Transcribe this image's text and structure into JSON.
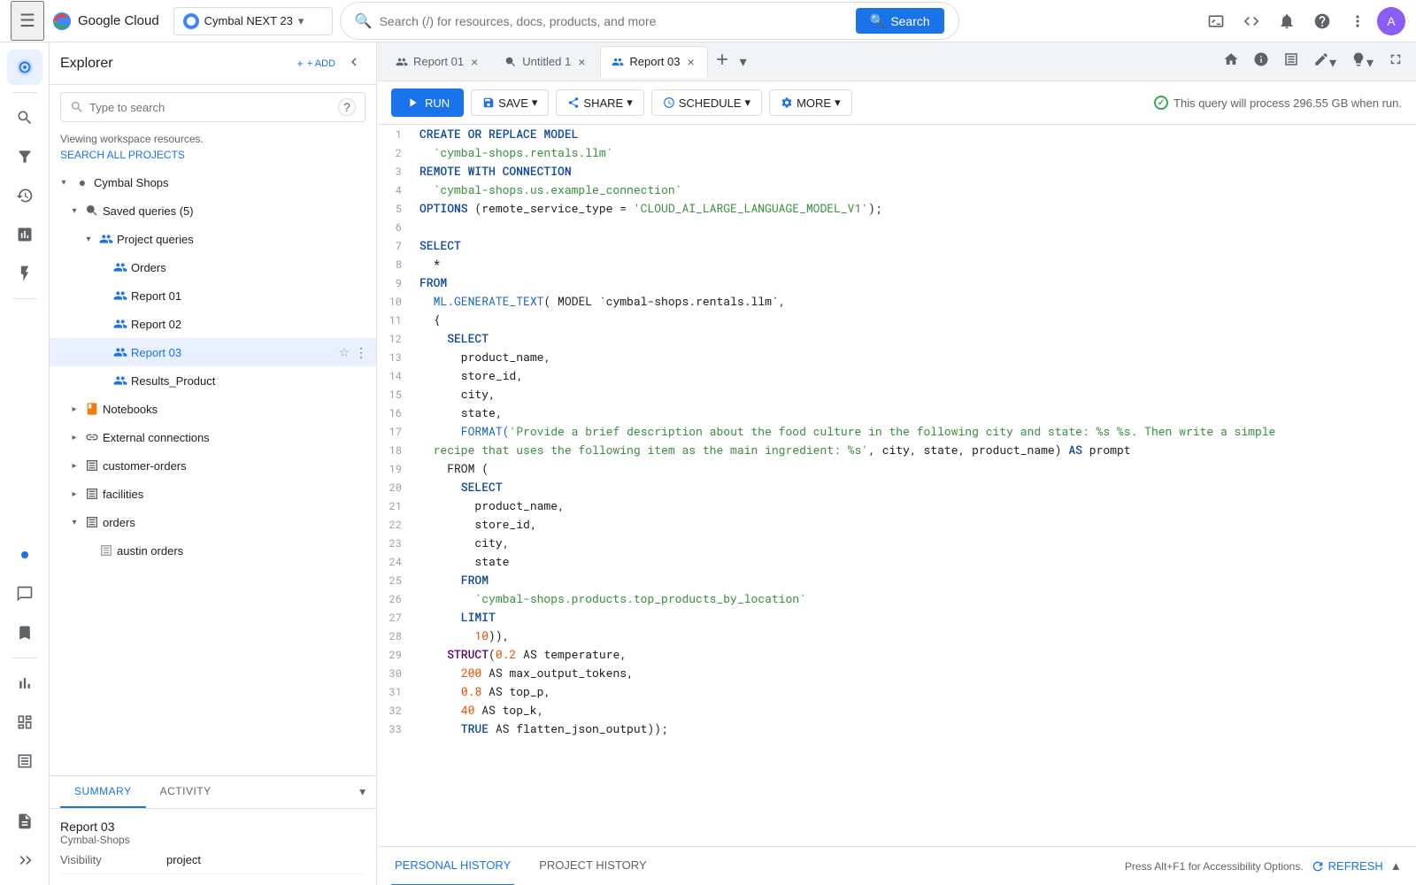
{
  "topnav": {
    "logo": {
      "letters": [
        {
          "char": "G",
          "color": "#4285f4"
        },
        {
          "char": "o",
          "color": "#ea4335"
        },
        {
          "char": "o",
          "color": "#fbbc04"
        },
        {
          "char": "g",
          "color": "#4285f4"
        },
        {
          "char": "l",
          "color": "#34a853"
        },
        {
          "char": "e",
          "color": "#ea4335"
        }
      ],
      "cloud_text": "Cloud"
    },
    "project": "Cymbal NEXT 23",
    "search_placeholder": "Search (/) for resources, docs, products, and more",
    "search_btn": "Search"
  },
  "explorer": {
    "title": "Explorer",
    "add_btn": "+ ADD",
    "search_placeholder": "Type to search",
    "workspace_text": "Viewing workspace resources.",
    "search_all_link": "SEARCH ALL PROJECTS"
  },
  "tree": {
    "items": [
      {
        "id": "cymbal-shops",
        "label": "Cymbal Shops",
        "indent": 0,
        "type": "folder",
        "expanded": true
      },
      {
        "id": "saved-queries",
        "label": "Saved queries (5)",
        "indent": 1,
        "type": "folder",
        "expanded": true
      },
      {
        "id": "project-queries",
        "label": "Project queries",
        "indent": 2,
        "type": "people-folder",
        "expanded": true
      },
      {
        "id": "orders",
        "label": "Orders",
        "indent": 3,
        "type": "people"
      },
      {
        "id": "report01",
        "label": "Report 01",
        "indent": 3,
        "type": "people"
      },
      {
        "id": "report02",
        "label": "Report 02",
        "indent": 3,
        "type": "people"
      },
      {
        "id": "report03",
        "label": "Report 03",
        "indent": 3,
        "type": "people",
        "active": true
      },
      {
        "id": "results-product",
        "label": "Results_Product",
        "indent": 3,
        "type": "people"
      },
      {
        "id": "notebooks",
        "label": "Notebooks",
        "indent": 1,
        "type": "notebook",
        "expanded": false
      },
      {
        "id": "ext-connections",
        "label": "External connections",
        "indent": 1,
        "type": "ext",
        "expanded": false
      },
      {
        "id": "customer-orders",
        "label": "customer-orders",
        "indent": 1,
        "type": "table",
        "expanded": false
      },
      {
        "id": "facilities",
        "label": "facilities",
        "indent": 1,
        "type": "table",
        "expanded": false
      },
      {
        "id": "orders-tbl",
        "label": "orders",
        "indent": 1,
        "type": "table",
        "expanded": true
      },
      {
        "id": "austin-orders",
        "label": "austin orders",
        "indent": 2,
        "type": "table-sub"
      }
    ]
  },
  "bottom_panel": {
    "tabs": [
      "SUMMARY",
      "ACTIVITY"
    ],
    "active_tab": "SUMMARY",
    "resource": {
      "name": "Report 03",
      "project": "Cymbal-Shops",
      "visibility_label": "Visibility",
      "visibility_value": "project"
    }
  },
  "tabs": [
    {
      "id": "report01",
      "label": "Report 01",
      "icon": "people",
      "active": false,
      "closeable": true
    },
    {
      "id": "untitled1",
      "label": "Untitled 1",
      "icon": "query",
      "active": false,
      "closeable": true
    },
    {
      "id": "report03",
      "label": "Report 03",
      "icon": "people",
      "active": true,
      "closeable": true
    }
  ],
  "toolbar": {
    "run_btn": "RUN",
    "save_btn": "SAVE",
    "share_btn": "SHARE",
    "schedule_btn": "SCHEDULE",
    "more_btn": "MORE",
    "info_text": "This query will process 296.55 GB when run."
  },
  "code": {
    "lines": [
      {
        "n": 1,
        "content": "CREATE OR REPLACE MODEL",
        "tokens": [
          {
            "t": "CREATE OR REPLACE MODEL",
            "c": "kw"
          }
        ]
      },
      {
        "n": 2,
        "content": "  `cymbal-shops.rentals.llm`",
        "tokens": [
          {
            "t": "  `cymbal-shops.rentals.llm`",
            "c": "str"
          }
        ]
      },
      {
        "n": 3,
        "content": "REMOTE WITH CONNECTION",
        "tokens": [
          {
            "t": "REMOTE WITH CONNECTION",
            "c": "kw"
          }
        ]
      },
      {
        "n": 4,
        "content": "  `cymbal-shops.us.example_connection`",
        "tokens": [
          {
            "t": "  `cymbal-shops.us.example_connection`",
            "c": "str"
          }
        ]
      },
      {
        "n": 5,
        "content": "OPTIONS (remote_service_type = 'CLOUD_AI_LARGE_LANGUAGE_MODEL_V1');",
        "tokens": [
          {
            "t": "OPTIONS",
            "c": "kw"
          },
          {
            "t": " (remote_service_type = ",
            "c": ""
          },
          {
            "t": "'CLOUD_AI_LARGE_LANGUAGE_MODEL_V1'",
            "c": "str"
          },
          {
            "t": ");",
            "c": ""
          }
        ]
      },
      {
        "n": 6,
        "content": ""
      },
      {
        "n": 7,
        "content": "SELECT",
        "tokens": [
          {
            "t": "SELECT",
            "c": "kw"
          }
        ]
      },
      {
        "n": 8,
        "content": "  *"
      },
      {
        "n": 9,
        "content": "FROM",
        "tokens": [
          {
            "t": "FROM",
            "c": "kw"
          }
        ]
      },
      {
        "n": 10,
        "content": "  ML.GENERATE_TEXT( MODEL `cymbal-shops.rentals.llm`,",
        "tokens": [
          {
            "t": "  ML.GENERATE_TEXT",
            "c": "fn"
          },
          {
            "t": "( MODEL `cymbal-shops.rentals.llm`,",
            "c": ""
          }
        ]
      },
      {
        "n": 11,
        "content": "  {"
      },
      {
        "n": 12,
        "content": "    SELECT",
        "tokens": [
          {
            "t": "    SELECT",
            "c": "kw"
          }
        ]
      },
      {
        "n": 13,
        "content": "      product_name,"
      },
      {
        "n": 14,
        "content": "      store_id,"
      },
      {
        "n": 15,
        "content": "      city,"
      },
      {
        "n": 16,
        "content": "      state,"
      },
      {
        "n": 17,
        "content": "      FORMAT('Provide a brief description about the food culture in the following city and state: %s %s. Then write a simple",
        "tokens": [
          {
            "t": "      FORMAT(",
            "c": "fn"
          },
          {
            "t": "'Provide a brief description about the food culture in the following city and state: %s %s. Then write a simple",
            "c": "str"
          }
        ]
      },
      {
        "n": 18,
        "content": "  recipe that uses the following item as the main ingredient: %s', city, state, product_name) AS prompt",
        "tokens": [
          {
            "t": "  recipe that uses the following item as the main ingredient: %s'",
            "c": "str"
          },
          {
            "t": ", city, state, product_name) ",
            "c": ""
          },
          {
            "t": "AS",
            "c": "kw"
          },
          {
            "t": " prompt",
            "c": ""
          }
        ]
      },
      {
        "n": 19,
        "content": "    FROM ("
      },
      {
        "n": 20,
        "content": "      SELECT",
        "tokens": [
          {
            "t": "      SELECT",
            "c": "kw"
          }
        ]
      },
      {
        "n": 21,
        "content": "        product_name,"
      },
      {
        "n": 22,
        "content": "        store_id,"
      },
      {
        "n": 23,
        "content": "        city,"
      },
      {
        "n": 24,
        "content": "        state"
      },
      {
        "n": 25,
        "content": "      FROM",
        "tokens": [
          {
            "t": "      FROM",
            "c": "kw"
          }
        ]
      },
      {
        "n": 26,
        "content": "        `cymbal-shops.products.top_products_by_location`",
        "tokens": [
          {
            "t": "        `cymbal-shops.products.top_products_by_location`",
            "c": "str"
          }
        ]
      },
      {
        "n": 27,
        "content": "      LIMIT",
        "tokens": [
          {
            "t": "      LIMIT",
            "c": "kw"
          }
        ]
      },
      {
        "n": 28,
        "content": "        10)),",
        "tokens": [
          {
            "t": "        ",
            "c": ""
          },
          {
            "t": "10",
            "c": "num"
          },
          {
            "t": ")),",
            "c": ""
          }
        ]
      },
      {
        "n": 29,
        "content": "    STRUCT(0.2 AS temperature,",
        "tokens": [
          {
            "t": "    STRUCT",
            "c": "struct-kw"
          },
          {
            "t": "(",
            "c": ""
          },
          {
            "t": "0.2",
            "c": "num"
          },
          {
            "t": " AS temperature,",
            "c": ""
          }
        ]
      },
      {
        "n": 30,
        "content": "      200 AS max_output_tokens,",
        "tokens": [
          {
            "t": "      ",
            "c": ""
          },
          {
            "t": "200",
            "c": "num"
          },
          {
            "t": " AS max_output_tokens,",
            "c": ""
          }
        ]
      },
      {
        "n": 31,
        "content": "      0.8 AS top_p,",
        "tokens": [
          {
            "t": "      ",
            "c": ""
          },
          {
            "t": "0.8",
            "c": "num"
          },
          {
            "t": " AS top_p,",
            "c": ""
          }
        ]
      },
      {
        "n": 32,
        "content": "      40 AS top_k,",
        "tokens": [
          {
            "t": "      ",
            "c": ""
          },
          {
            "t": "40",
            "c": "num"
          },
          {
            "t": " AS top_k,",
            "c": ""
          }
        ]
      },
      {
        "n": 33,
        "content": "      TRUE AS flatten_json_output));",
        "tokens": [
          {
            "t": "      TRUE",
            "c": "kw"
          },
          {
            "t": " AS flatten_json_output));",
            "c": ""
          }
        ]
      }
    ]
  },
  "history_bar": {
    "personal_history": "PERSONAL HISTORY",
    "project_history": "PROJECT HISTORY",
    "accessibility_text": "Press Alt+F1 for Accessibility Options.",
    "refresh_btn": "REFRESH",
    "active_tab": "PERSONAL HISTORY"
  }
}
